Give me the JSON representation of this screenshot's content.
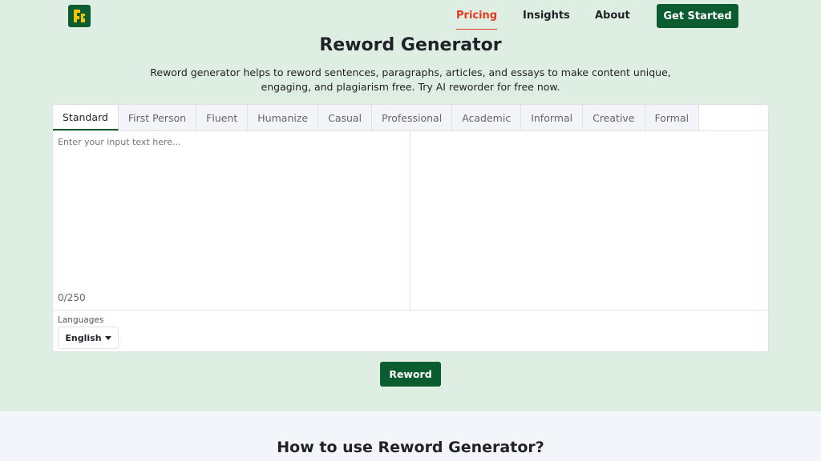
{
  "nav": {
    "pricing": "Pricing",
    "insights": "Insights",
    "about": "About",
    "get_started": "Get Started"
  },
  "hero": {
    "title": "Reword Generator",
    "description": "Reword generator helps to reword sentences, paragraphs, articles, and essays to make content unique, engaging, and plagiarism free. Try AI reworder for free now."
  },
  "tabs": [
    "Standard",
    "First Person",
    "Fluent",
    "Humanize",
    "Casual",
    "Professional",
    "Academic",
    "Informal",
    "Creative",
    "Formal"
  ],
  "editor": {
    "placeholder": "Enter your input text here...",
    "counter": "0/250"
  },
  "languages": {
    "label": "Languages",
    "selected": "English"
  },
  "reword_label": "Reword",
  "section": {
    "howto_title": "How to use Reword Generator?"
  },
  "colors": {
    "brand_green": "#0b5c2f",
    "accent_red": "#e63b1f",
    "hero_bg": "#deeee3"
  },
  "icons": {
    "logo": "brand-logo-icon",
    "dropdown": "caret-down-icon"
  }
}
